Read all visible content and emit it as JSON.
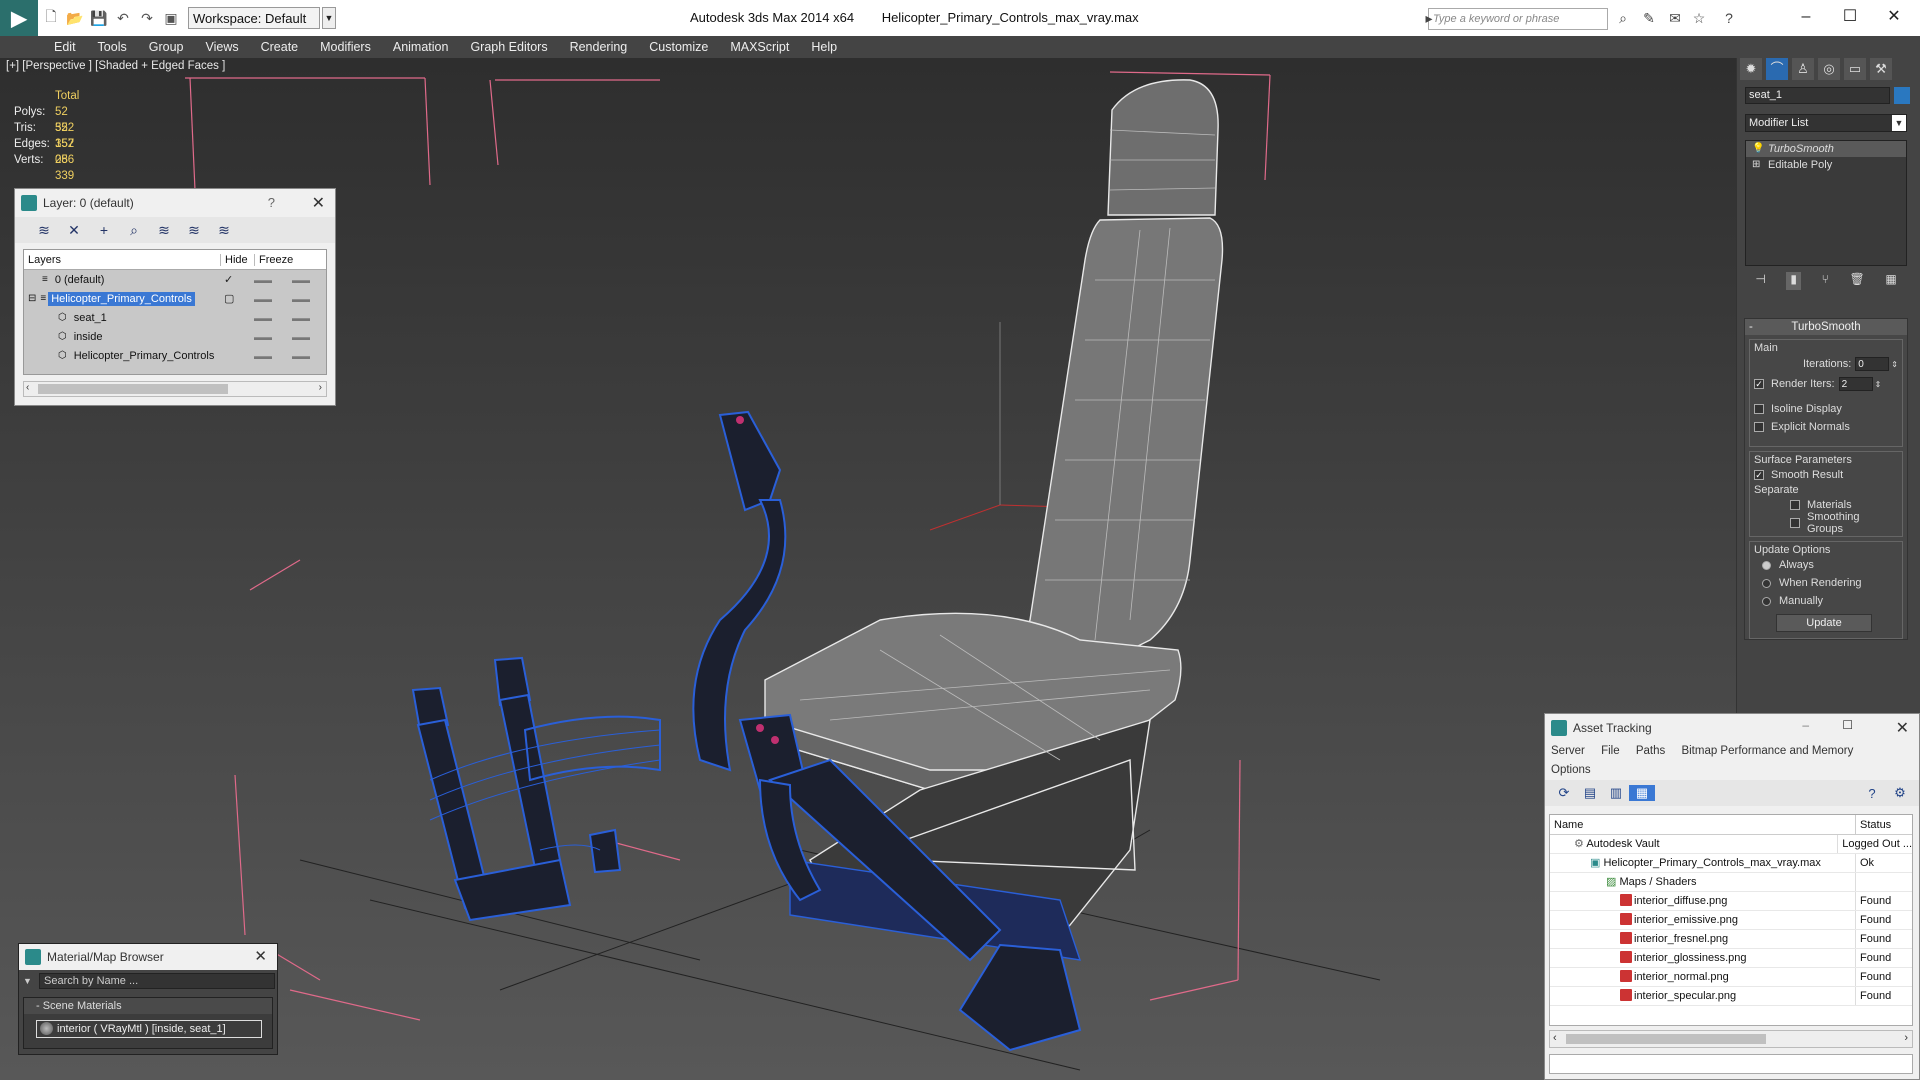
{
  "titlebar": {
    "workspace": "Workspace: Default",
    "app_name": "Autodesk 3ds Max  2014 x64",
    "file_name": "Helicopter_Primary_Controls_max_vray.max",
    "search_placeholder": "Type a keyword or phrase"
  },
  "menu": [
    "Edit",
    "Tools",
    "Group",
    "Views",
    "Create",
    "Modifiers",
    "Animation",
    "Graph Editors",
    "Rendering",
    "Customize",
    "MAXScript",
    "Help"
  ],
  "viewport": {
    "label": "[+] [Perspective ] [Shaded + Edged Faces ]",
    "stats": {
      "total_label": "Total",
      "polys_label": "Polys:",
      "polys": "52 352",
      "tris_label": "Tris:",
      "tris": "52 352",
      "edges_label": "Edges:",
      "edges": "157 056",
      "verts_label": "Verts:",
      "verts": "28 339"
    }
  },
  "layer_dialog": {
    "title": "Layer: 0 (default)",
    "help": "?",
    "col_layers": "Layers",
    "col_hide": "Hide",
    "col_freeze": "Freeze",
    "rows": [
      {
        "name": "0 (default)"
      },
      {
        "name": "Helicopter_Primary_Controls"
      },
      {
        "name": "seat_1"
      },
      {
        "name": "inside"
      },
      {
        "name": "Helicopter_Primary_Controls"
      }
    ]
  },
  "command_panel": {
    "object_name": "seat_1",
    "object_color": "#2a78c0",
    "modifier_list": "Modifier List",
    "stack": [
      "TurboSmooth",
      "Editable Poly"
    ],
    "turbosmooth": {
      "title": "TurboSmooth",
      "main_label": "Main",
      "iterations_label": "Iterations:",
      "iterations": "0",
      "render_iters_label": "Render Iters:",
      "render_iters": "2",
      "isoline": "Isoline Display",
      "explicit_normals": "Explicit Normals",
      "surface_params": "Surface Parameters",
      "smooth_result": "Smooth Result",
      "separate": "Separate",
      "materials": "Materials",
      "smoothing_groups": "Smoothing Groups",
      "update_options": "Update Options",
      "always": "Always",
      "when_rendering": "When Rendering",
      "manually": "Manually",
      "update_button": "Update"
    }
  },
  "asset_tracking": {
    "title": "Asset Tracking",
    "menu": [
      "Server",
      "File",
      "Paths",
      "Bitmap Performance and Memory"
    ],
    "menu2": "Options",
    "col_name": "Name",
    "col_status": "Status",
    "rows": [
      {
        "name": "Autodesk Vault",
        "status": "Logged Out ..."
      },
      {
        "name": "Helicopter_Primary_Controls_max_vray.max",
        "status": "Ok"
      },
      {
        "name": "Maps / Shaders",
        "status": ""
      },
      {
        "name": "interior_diffuse.png",
        "status": "Found"
      },
      {
        "name": "interior_emissive.png",
        "status": "Found"
      },
      {
        "name": "interior_fresnel.png",
        "status": "Found"
      },
      {
        "name": "interior_glossiness.png",
        "status": "Found"
      },
      {
        "name": "interior_normal.png",
        "status": "Found"
      },
      {
        "name": "interior_specular.png",
        "status": "Found"
      }
    ]
  },
  "material_browser": {
    "title": "Material/Map Browser",
    "search_placeholder": "Search by Name ...",
    "group": "- Scene Materials",
    "item": "interior  ( VRayMtl ) [inside, seat_1]"
  },
  "colors": {
    "selection": "#3a78d4",
    "wire_blue": "#2a5fd8",
    "wire_white": "#e8e8e8",
    "stats_value": "#f0d060"
  }
}
